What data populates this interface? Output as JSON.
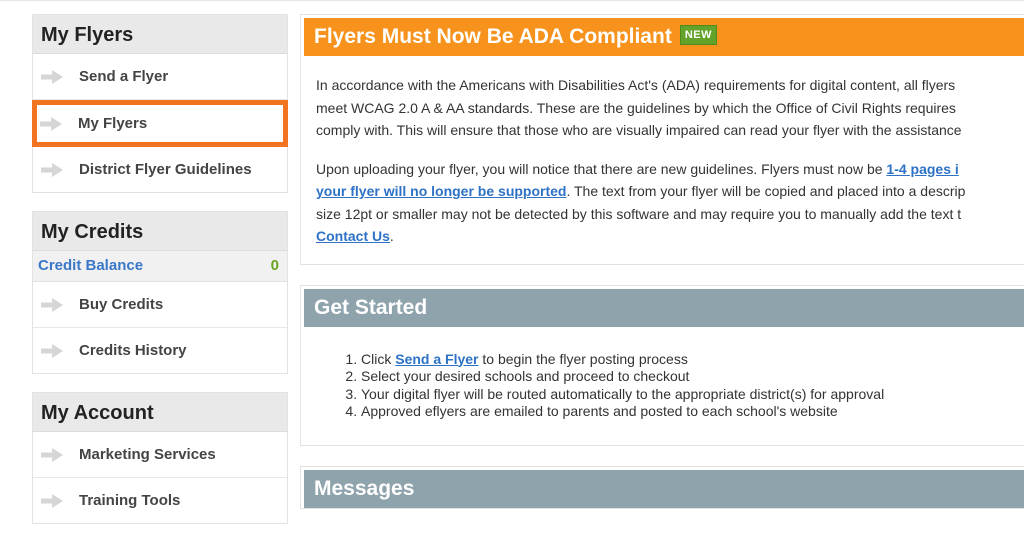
{
  "sidebar": {
    "my_flyers": {
      "title": "My Flyers",
      "items": [
        "Send a Flyer",
        "My Flyers",
        "District Flyer Guidelines"
      ],
      "active": "My Flyers"
    },
    "my_credits": {
      "title": "My Credits",
      "balance_label": "Credit Balance",
      "balance_value": "0",
      "items": [
        "Buy Credits",
        "Credits History"
      ]
    },
    "my_account": {
      "title": "My Account",
      "items": [
        "Marketing Services",
        "Training Tools"
      ]
    }
  },
  "ada": {
    "title": "Flyers Must Now Be ADA Compliant",
    "badge": "NEW",
    "p1_line1": "In accordance with the Americans with Disabilities Act's (ADA) requirements for digital content, all flyers",
    "p1_line2": "meet WCAG 2.0 A & AA standards. These are the guidelines by which the Office of Civil Rights requires",
    "p1_line3": "comply with. This will ensure that those who are visually impaired can read your flyer with the assistance",
    "p2_line1_text": "Upon uploading your flyer, you will notice that there are new guidelines. Flyers must now be ",
    "p2_line1_link": "1-4 pages i",
    "p2_line2_link": "your flyer will no longer be supported",
    "p2_line2_text": ". The text from your flyer will be copied and placed into a descrip",
    "p2_line3": "size 12pt or smaller may not be detected by this software and may require you to manually add the text t",
    "p2_line4_link": "Contact Us",
    "p2_line4_text": "."
  },
  "get_started": {
    "title": "Get Started",
    "step1_prefix": "Click ",
    "step1_link": "Send a Flyer",
    "step1_suffix": " to begin the flyer posting process",
    "step2": "Select your desired schools and proceed to checkout",
    "step3": "Your digital flyer will be routed automatically to the appropriate district(s) for approval",
    "step4": "Approved eflyers are emailed to parents and posted to each school's website"
  },
  "messages": {
    "title": "Messages"
  },
  "icons": {
    "nav_arrow": "arrow-right-icon"
  },
  "colors": {
    "accent_orange": "#f7931d",
    "active_border": "#f27421",
    "header_slate": "#8fa3ad",
    "link_blue": "#2d72c6",
    "badge_green": "#64a32a"
  }
}
